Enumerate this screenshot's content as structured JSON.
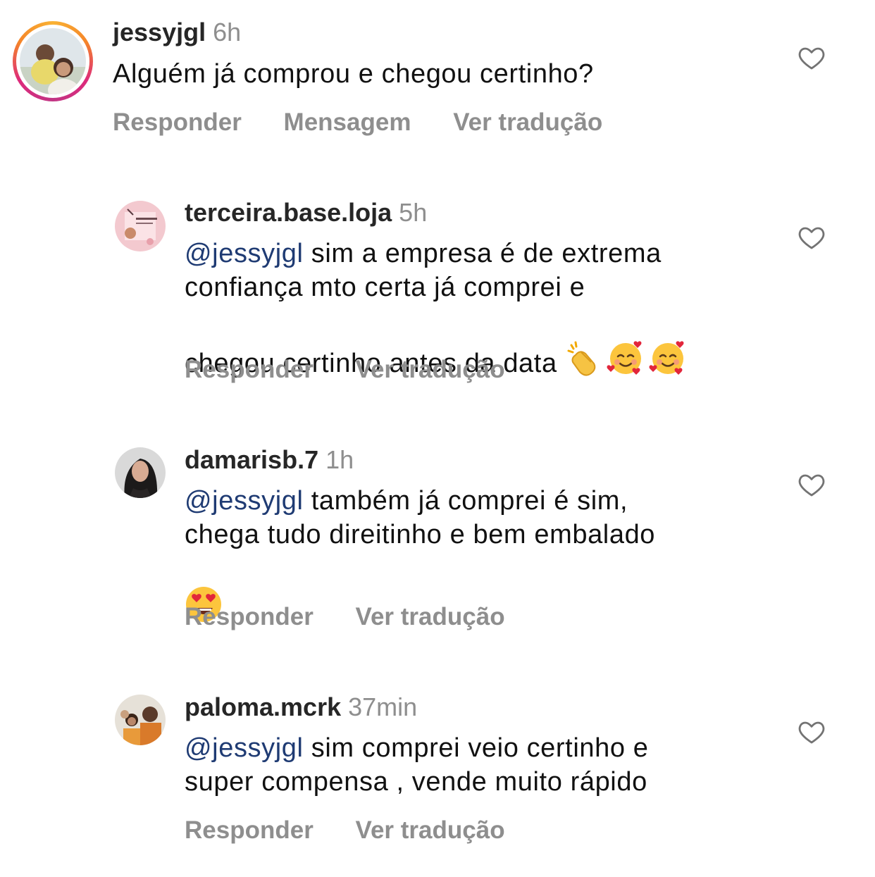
{
  "comments": [
    {
      "username": "jessyjgl",
      "time": "6h",
      "text": "Alguém já comprou e chegou certinho?",
      "actions": [
        "Responder",
        "Mensagem",
        "Ver tradução"
      ]
    },
    {
      "username": "terceira.base.loja",
      "time": "5h",
      "mention": "@jessyjgl",
      "text": "sim a empresa é de extrema\nconfiança mto certa já comprei e\nchegou certinho antes da data",
      "emojis": [
        "clapping-hands",
        "smiling-face-with-hearts",
        "smiling-face-with-hearts"
      ],
      "actions": [
        "Responder",
        "Ver tradução"
      ]
    },
    {
      "username": "damarisb.7",
      "time": "1h",
      "mention": "@jessyjgl",
      "text": "também já comprei é sim,\nchega tudo direitinho e bem embalado",
      "emojis": [
        "smiling-face-with-heart-eyes"
      ],
      "actions": [
        "Responder",
        "Ver tradução"
      ]
    },
    {
      "username": "paloma.mcrk",
      "time": "37min",
      "mention": "@jessyjgl",
      "text": "sim comprei veio certinho e\nsuper compensa , vende muito rápido",
      "actions": [
        "Responder",
        "Ver tradução"
      ]
    }
  ],
  "icons": {
    "like": "heart-outline-icon"
  },
  "colors": {
    "mention": "#1f3b73",
    "secondary": "#8e8e8e",
    "story_ring": [
      "#f9b234",
      "#dd2a7b"
    ]
  }
}
